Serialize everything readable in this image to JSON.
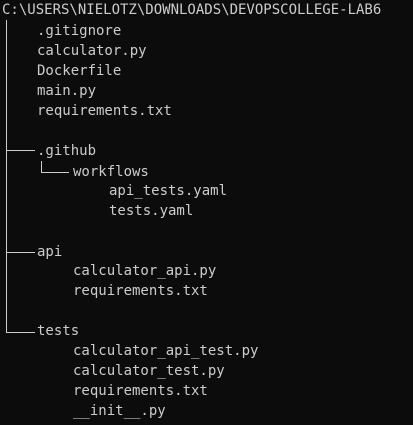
{
  "terminal": {
    "root_path": "C:\\USERS\\NIELOTZ\\DOWNLOADS\\DEVOPSCOLLEGE-LAB6",
    "root_files": [
      ".gitignore",
      "calculator.py",
      "Dockerfile",
      "main.py",
      "requirements.txt"
    ],
    "folders": {
      "github": {
        "name": ".github",
        "subfolder": "workflows",
        "files": [
          "api_tests.yaml",
          "tests.yaml"
        ]
      },
      "api": {
        "name": "api",
        "files": [
          "calculator_api.py",
          "requirements.txt"
        ]
      },
      "tests": {
        "name": "tests",
        "files": [
          "calculator_api_test.py",
          "calculator_test.py",
          "requirements.txt",
          "__init__.py"
        ]
      }
    }
  },
  "colors": {
    "background": "#0c0c0c",
    "foreground": "#cccccc"
  }
}
